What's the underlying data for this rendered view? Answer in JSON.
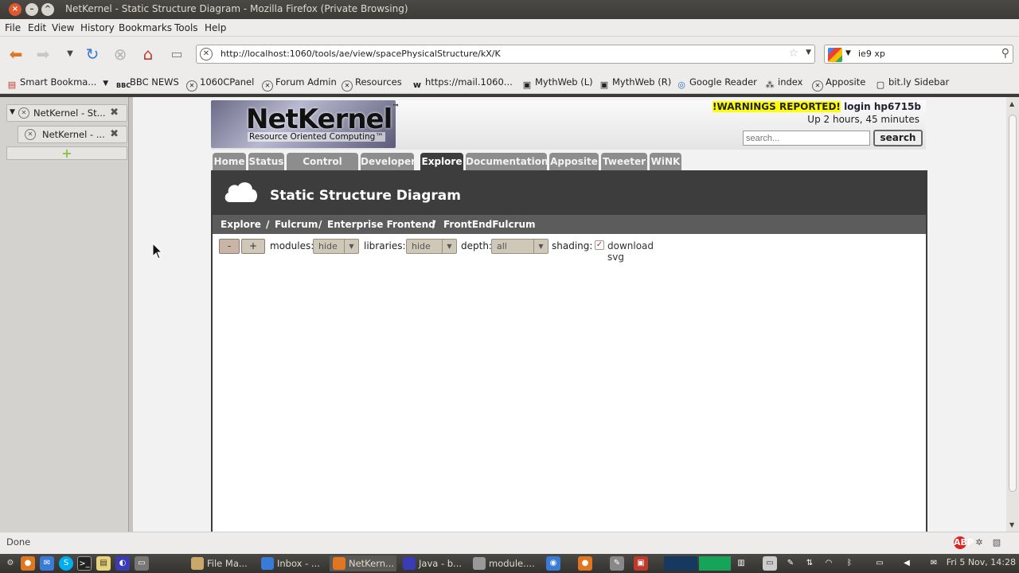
{
  "window": {
    "title": "NetKernel - Static Structure Diagram - Mozilla Firefox (Private Browsing)"
  },
  "menu": [
    "File",
    "Edit",
    "View",
    "History",
    "Bookmarks",
    "Tools",
    "Help"
  ],
  "navigation": {
    "url": "http://localhost:1060/tools/ae/view/spacePhysicalStructure/kX/K",
    "search_value": "ie9 xp"
  },
  "bookmarks": [
    {
      "label": "Smart Bookma...",
      "icon": "folder-icon"
    },
    {
      "label": "BBC NEWS",
      "icon": "bbc-icon"
    },
    {
      "label": "1060CPanel",
      "icon": "netkernel-icon"
    },
    {
      "label": "Forum Admin",
      "icon": "netkernel-icon"
    },
    {
      "label": "Resources",
      "icon": "netkernel-icon"
    },
    {
      "label": "https://mail.1060...",
      "icon": "web-icon"
    },
    {
      "label": "MythWeb (L)",
      "icon": "mythweb-icon"
    },
    {
      "label": "MythWeb (R)",
      "icon": "mythweb-icon"
    },
    {
      "label": "Google Reader",
      "icon": "reader-icon"
    },
    {
      "label": "index",
      "icon": "index-icon"
    },
    {
      "label": "Apposite",
      "icon": "netkernel-icon"
    },
    {
      "label": "bit.ly Sidebar",
      "icon": "bitly-icon"
    }
  ],
  "sidebar": {
    "tabs": [
      {
        "label": "NetKernel - St..."
      },
      {
        "label": "NetKernel - ..."
      }
    ]
  },
  "page": {
    "logo_name": "NetKernel",
    "logo_tm": "™",
    "logo_tagline": "Resource Oriented Computing™",
    "warning": "!WARNINGS REPORTED!",
    "login": "login hp6715b",
    "uptime": "Up 2 hours, 45 minutes",
    "search_placeholder": "search...",
    "search_button": "search",
    "tabs": [
      "Home",
      "Status",
      "Control Panel",
      "Developer",
      "Explore",
      "Documentation",
      "Apposite",
      "Tweeter",
      "WiNK"
    ],
    "active_tab": "Explore",
    "panel_title": "Static Structure Diagram",
    "breadcrumbs": [
      "Explore",
      "/",
      "Fulcrum",
      "/",
      "Enterprise Frontend",
      "/",
      "FrontEndFulcrum"
    ],
    "controls": {
      "minus": "-",
      "plus": "+",
      "modules_label": "modules:",
      "modules_value": "hide",
      "libraries_label": "libraries:",
      "libraries_value": "hide",
      "depth_label": "depth:",
      "depth_value": "all",
      "shading_label": "shading:",
      "shading_checked": true,
      "download_label": "download svg"
    }
  },
  "status": {
    "text": "Done"
  },
  "taskbar": {
    "tasks": [
      {
        "label": "File Ma...",
        "active": false
      },
      {
        "label": "Inbox - ...",
        "active": false
      },
      {
        "label": "NetKern...",
        "active": true
      },
      {
        "label": "Java - b...",
        "active": false
      },
      {
        "label": "module....",
        "active": false
      }
    ],
    "clock": "Fri 5 Nov, 14:28"
  },
  "colors": {
    "warning_highlight": "#ffff00",
    "panel_dark": "#3d3d3d",
    "tab_inactive": "#8d8d8d"
  }
}
